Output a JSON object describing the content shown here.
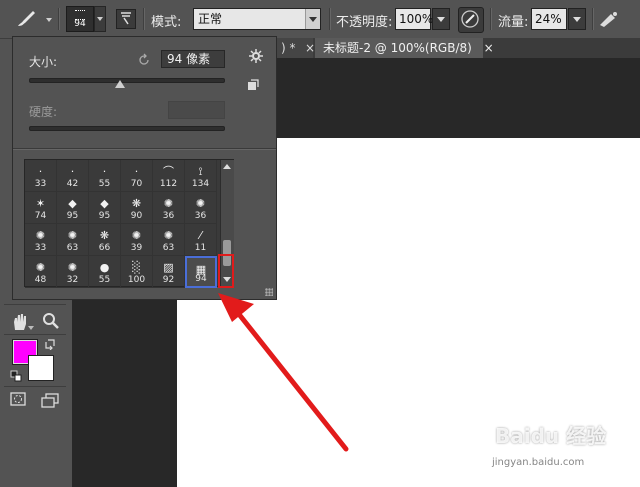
{
  "options_bar": {
    "brush_size_value": "94",
    "mode_label": "模式:",
    "mode_value": "正常",
    "opacity_label": "不透明度:",
    "opacity_value": "100%",
    "flow_label": "流量:",
    "flow_value": "24%"
  },
  "tabs": [
    {
      "label": ") *",
      "close": "×"
    },
    {
      "label": "未标题-2 @ 100%(RGB/8)",
      "close": "×"
    }
  ],
  "brush_panel": {
    "size_label": "大小:",
    "size_value": "94 像素",
    "hardness_label": "硬度:",
    "presets": [
      [
        {
          "n": "33"
        },
        {
          "n": "42"
        },
        {
          "n": "55"
        },
        {
          "n": "70"
        },
        {
          "n": "112"
        },
        {
          "n": "134"
        }
      ],
      [
        {
          "n": "74"
        },
        {
          "n": "95"
        },
        {
          "n": "95"
        },
        {
          "n": "90"
        },
        {
          "n": "36"
        },
        {
          "n": "36"
        }
      ],
      [
        {
          "n": "33"
        },
        {
          "n": "63"
        },
        {
          "n": "66"
        },
        {
          "n": "39"
        },
        {
          "n": "63"
        },
        {
          "n": "11"
        }
      ],
      [
        {
          "n": "48"
        },
        {
          "n": "32"
        },
        {
          "n": "55"
        },
        {
          "n": "100"
        },
        {
          "n": "92"
        },
        {
          "n": "94"
        }
      ]
    ],
    "selected_preset": "94"
  },
  "colors": {
    "foreground": "#ff00ff",
    "background": "#ffffff",
    "highlight": "#e01b1b"
  },
  "watermark": {
    "brand": "Baidu 经验",
    "url": "jingyan.baidu.com"
  }
}
